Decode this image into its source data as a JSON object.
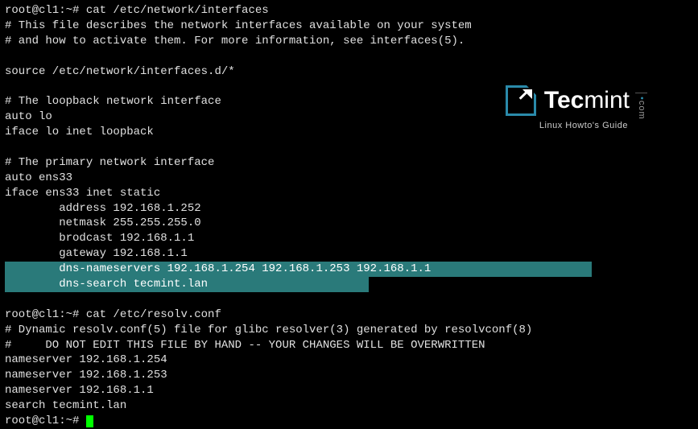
{
  "logo": {
    "brand_part1": "Tec",
    "brand_part2": "mint",
    "tagline": "Linux Howto's Guide",
    "tld": "com"
  },
  "terminal": {
    "prompt1": "root@cl1:~# ",
    "command1": "cat /etc/network/interfaces",
    "file1_line1": "# This file describes the network interfaces available on your system",
    "file1_line2": "# and how to activate them. For more information, see interfaces(5).",
    "file1_blank1": "",
    "file1_line3": "source /etc/network/interfaces.d/*",
    "file1_blank2": "",
    "file1_line4": "# The loopback network interface",
    "file1_line5": "auto lo",
    "file1_line6": "iface lo inet loopback",
    "file1_blank3": "",
    "file1_line7": "# The primary network interface",
    "file1_line8": "auto ens33",
    "file1_line9": "iface ens33 inet static",
    "file1_line10": "        address 192.168.1.252",
    "file1_line11": "        netmask 255.255.255.0",
    "file1_line12": "        brodcast 192.168.1.1",
    "file1_line13": "        gateway 192.168.1.1",
    "file1_hl1": "        dns-nameservers 192.168.1.254 192.168.1.253 192.168.1.1",
    "file1_hl2": "        dns-search tecmint.lan",
    "file1_blank4": "",
    "prompt2": "root@cl1:~# ",
    "command2": "cat /etc/resolv.conf",
    "file2_line1": "# Dynamic resolv.conf(5) file for glibc resolver(3) generated by resolvconf(8)",
    "file2_line2": "#     DO NOT EDIT THIS FILE BY HAND -- YOUR CHANGES WILL BE OVERWRITTEN",
    "file2_line3": "nameserver 192.168.1.254",
    "file2_line4": "nameserver 192.168.1.253",
    "file2_line5": "nameserver 192.168.1.1",
    "file2_line6": "search tecmint.lan",
    "prompt3": "root@cl1:~# "
  }
}
